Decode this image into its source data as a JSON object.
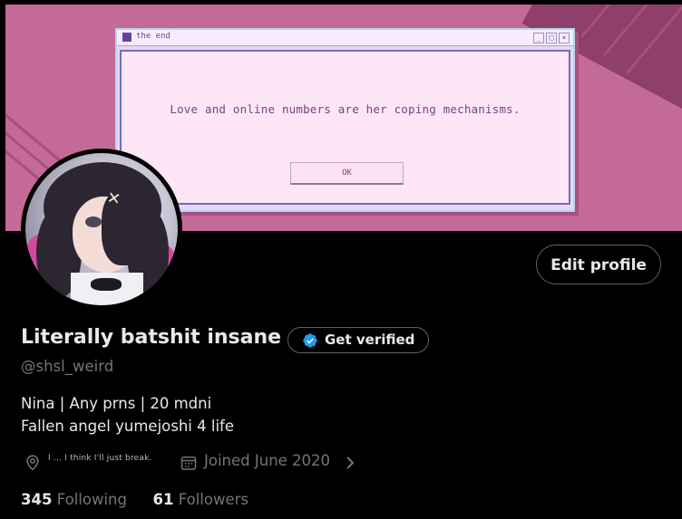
{
  "banner": {
    "window_title": "the end",
    "window_message": "Love and online numbers are her coping mechanisms.",
    "ok_label": "OK",
    "controls": [
      "_",
      "□",
      "×"
    ]
  },
  "profile": {
    "edit_label": "Edit profile",
    "display_name": "Literally batshit insane",
    "verify_label": "Get verified",
    "handle": "@shsl_weird",
    "bio_lines": [
      "Nina | Any prns | 20 mdni",
      "Fallen angel yumejoshi 4 life"
    ],
    "location": "I ... I think I'll just break.",
    "joined": "Joined June 2020"
  },
  "stats": {
    "following_count": "345",
    "following_label": "Following",
    "followers_count": "61",
    "followers_label": "Followers"
  },
  "colors": {
    "banner": "#c46a98",
    "verified_blue": "#1d9bf0",
    "muted": "#71767b"
  }
}
